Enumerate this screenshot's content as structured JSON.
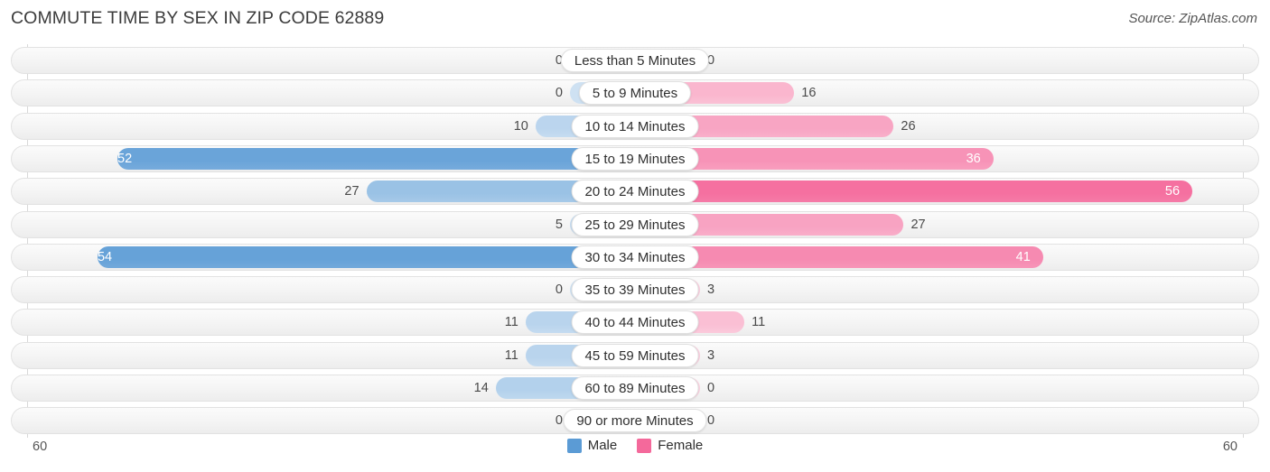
{
  "header": {
    "title": "COMMUTE TIME BY SEX IN ZIP CODE 62889",
    "source": "Source: ZipAtlas.com"
  },
  "axis": {
    "left_label": "60",
    "right_label": "60"
  },
  "legend": {
    "items": [
      {
        "label": "Male",
        "color": "#5b9bd5"
      },
      {
        "label": "Female",
        "color": "#f4699b"
      }
    ]
  },
  "chart_data": {
    "type": "bar",
    "title": "COMMUTE TIME BY SEX IN ZIP CODE 62889",
    "subtitle": "Source: ZipAtlas.com",
    "orientation": "horizontal",
    "layout": "diverging-bidirectional",
    "xlabel": "",
    "ylabel": "",
    "xlim": [
      60,
      60
    ],
    "axis_max": 60,
    "grid": false,
    "legend_position": "bottom-center",
    "categories": [
      "Less than 5 Minutes",
      "5 to 9 Minutes",
      "10 to 14 Minutes",
      "15 to 19 Minutes",
      "20 to 24 Minutes",
      "25 to 29 Minutes",
      "30 to 34 Minutes",
      "35 to 39 Minutes",
      "40 to 44 Minutes",
      "45 to 59 Minutes",
      "60 to 89 Minutes",
      "90 or more Minutes"
    ],
    "series": [
      {
        "name": "Male",
        "color": "#5b9bd5",
        "side": "left",
        "values": [
          0,
          0,
          10,
          52,
          27,
          5,
          54,
          0,
          11,
          11,
          14,
          0
        ],
        "labels": [
          "0",
          "0",
          "10",
          "52",
          "27",
          "5",
          "54",
          "0",
          "11",
          "11",
          "14",
          "0"
        ]
      },
      {
        "name": "Female",
        "color": "#f4699b",
        "side": "right",
        "values": [
          0,
          16,
          26,
          36,
          56,
          27,
          41,
          3,
          11,
          3,
          0,
          0
        ],
        "labels": [
          "0",
          "16",
          "26",
          "36",
          "56",
          "27",
          "41",
          "3",
          "11",
          "3",
          "0",
          "0"
        ]
      }
    ]
  }
}
